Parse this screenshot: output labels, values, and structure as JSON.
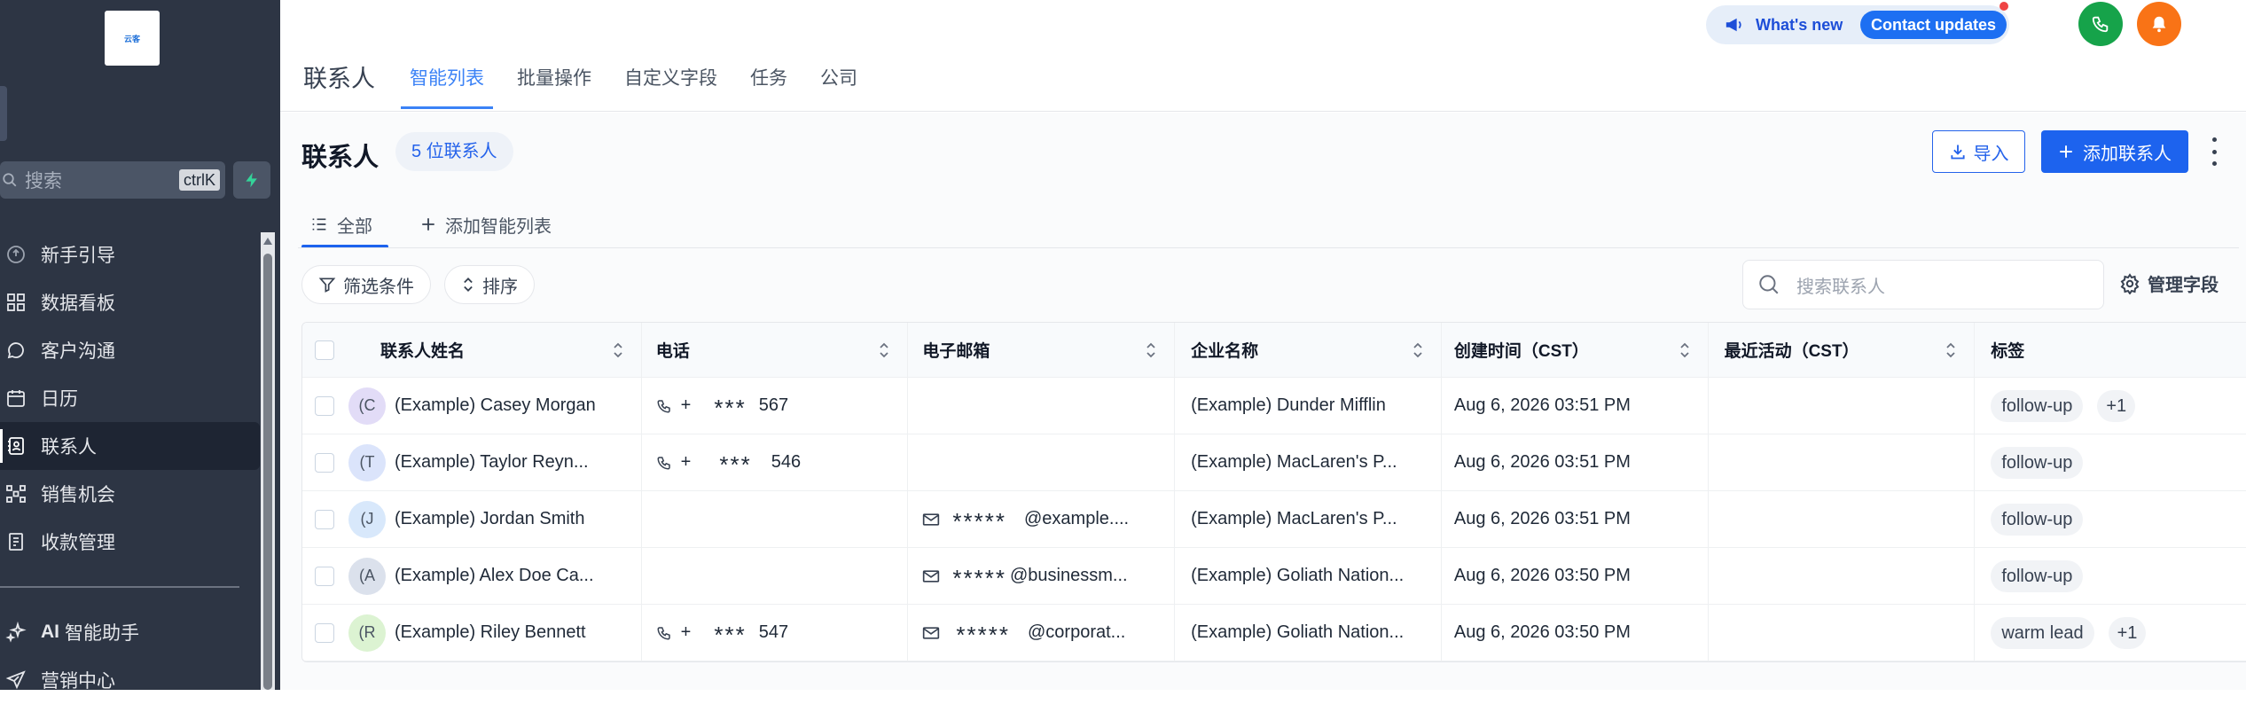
{
  "sidebar": {
    "logo_text": "云客",
    "search_placeholder": "搜索",
    "search_shortcut": "ctrlK",
    "nav": [
      {
        "label": "新手引导",
        "icon": "guide-icon"
      },
      {
        "label": "数据看板",
        "icon": "dashboard-icon"
      },
      {
        "label": "客户沟通",
        "icon": "chat-icon"
      },
      {
        "label": "日历",
        "icon": "calendar-icon"
      },
      {
        "label": "联系人",
        "icon": "contacts-icon",
        "active": true
      },
      {
        "label": "销售机会",
        "icon": "opportunity-icon"
      },
      {
        "label": "收款管理",
        "icon": "payment-icon"
      }
    ],
    "ai_label": "智能助手",
    "ai_prefix": "AI",
    "marketing_label": "营销中心"
  },
  "topbar": {
    "heading": "联系人",
    "tabs": [
      "智能列表",
      "批量操作",
      "自定义字段",
      "任务",
      "公司"
    ],
    "active_tab": 0,
    "whats_new": "What's new",
    "contact_updates": "Contact updates"
  },
  "main": {
    "title": "联系人",
    "count": "5 位联系人",
    "import_label": "导入",
    "add_label": "添加联系人",
    "list_tab_all": "全部",
    "list_tab_add": "添加智能列表",
    "filter_label": "筛选条件",
    "sort_label": "排序",
    "search_placeholder": "搜索联系人",
    "manage_fields": "管理字段"
  },
  "table": {
    "columns": [
      "联系人姓名",
      "电话",
      "电子邮箱",
      "企业名称",
      "创建时间（CST）",
      "最近活动（CST）",
      "标签"
    ],
    "rows": [
      {
        "initial": "(C",
        "avatar_color": "#e2dcf7",
        "name": "(Example) Casey Morgan",
        "phone_prefix": "+",
        "phone_mask": "***",
        "phone_suffix": "567",
        "email_mask": "",
        "email_domain": "",
        "company": "(Example) Dunder Mifflin",
        "created": "Aug 6, 2026 03:51 PM",
        "activity": "",
        "tag": "follow-up",
        "more": "+1"
      },
      {
        "initial": "(T",
        "avatar_color": "#dbe4fb",
        "name": "(Example) Taylor Reyn...",
        "phone_prefix": "+",
        "phone_mask": "***",
        "phone_suffix": "546",
        "email_mask": "",
        "email_domain": "",
        "company": "(Example) MacLaren's P...",
        "created": "Aug 6, 2026 03:51 PM",
        "activity": "",
        "tag": "follow-up",
        "more": ""
      },
      {
        "initial": "(J",
        "avatar_color": "#d8e8fb",
        "name": "(Example) Jordan Smith",
        "phone_prefix": "",
        "phone_mask": "",
        "phone_suffix": "",
        "email_mask": "*****",
        "email_domain": "@example....",
        "company": "(Example) MacLaren's P...",
        "created": "Aug 6, 2026 03:51 PM",
        "activity": "",
        "tag": "follow-up",
        "more": ""
      },
      {
        "initial": "(A",
        "avatar_color": "#dbe1ec",
        "name": "(Example) Alex Doe Ca...",
        "phone_prefix": "",
        "phone_mask": "",
        "phone_suffix": "",
        "email_mask": "*****",
        "email_domain": "@businessm...",
        "company": "(Example) Goliath Nation...",
        "created": "Aug 6, 2026 03:50 PM",
        "activity": "",
        "tag": "follow-up",
        "more": ""
      },
      {
        "initial": "(R",
        "avatar_color": "#dcf3d2",
        "name": "(Example) Riley Bennett",
        "phone_prefix": "+",
        "phone_mask": "***",
        "phone_suffix": "547",
        "email_mask": "*****",
        "email_domain": "@corporat...",
        "company": "(Example) Goliath Nation...",
        "created": "Aug 6, 2026 03:50 PM",
        "activity": "",
        "tag": "warm lead",
        "more": "+1"
      }
    ]
  },
  "colors": {
    "sidebar_bg": "#2d3544",
    "primary": "#1d63ee",
    "active_tab": "#3b82f6"
  }
}
